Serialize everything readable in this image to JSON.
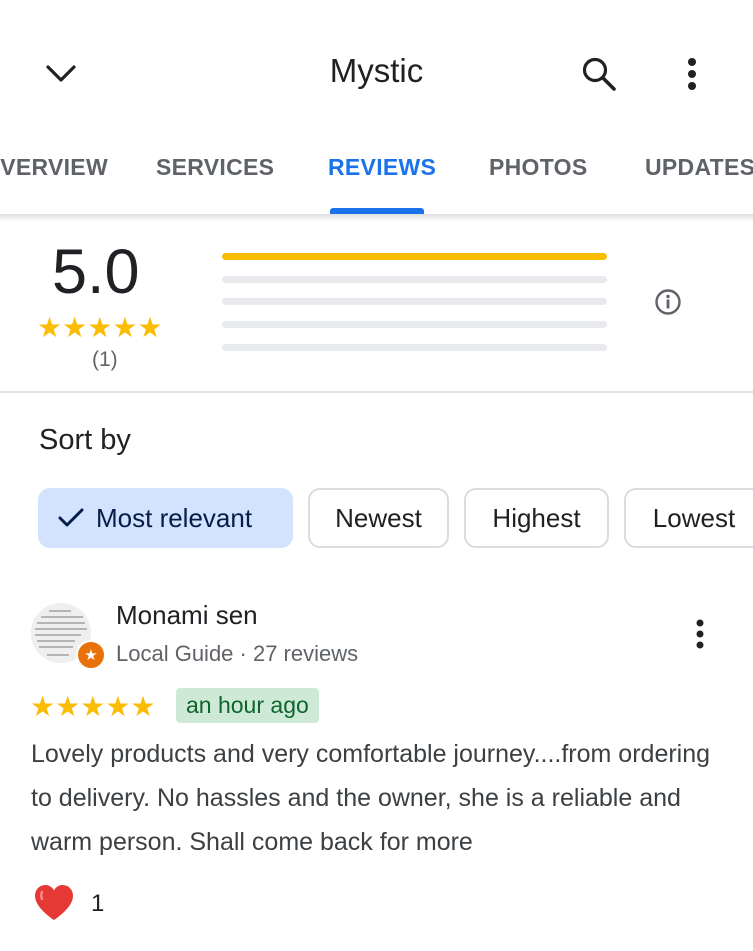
{
  "header": {
    "title": "Mystic",
    "back_icon": "chevron-down-icon",
    "search_icon": "search-icon",
    "menu_icon": "more-vert-icon"
  },
  "tabs": [
    {
      "label": "OVERVIEW",
      "active": false
    },
    {
      "label": "SERVICES",
      "active": false
    },
    {
      "label": "REVIEWS",
      "active": true
    },
    {
      "label": "PHOTOS",
      "active": false
    },
    {
      "label": "UPDATES",
      "active": false
    }
  ],
  "summary": {
    "rating": "5.0",
    "stars": 5,
    "count": "(1)",
    "distribution": [
      {
        "stars": 5,
        "fraction": 1.0
      },
      {
        "stars": 4,
        "fraction": 0
      },
      {
        "stars": 3,
        "fraction": 0
      },
      {
        "stars": 2,
        "fraction": 0
      },
      {
        "stars": 1,
        "fraction": 0
      }
    ],
    "info_icon": "info-icon"
  },
  "sort": {
    "label": "Sort by",
    "options": [
      "Most relevant",
      "Newest",
      "Highest",
      "Lowest"
    ],
    "selected": "Most relevant"
  },
  "review": {
    "author": "Monami sen",
    "meta": "Local Guide · 27 reviews",
    "stars": 5,
    "time": "an hour ago",
    "text": "Lovely products and very comfortable journey....from ordering to delivery. No hassles and the owner, she is a reliable and warm person. Shall come back for more",
    "likes": "1",
    "colors": {
      "star": "#fbbc04",
      "badge_bg": "#ceead6",
      "badge_text": "#0d652d",
      "local_guide": "#e8710a"
    }
  },
  "colors": {
    "accent": "#1a73e8",
    "chip_selected": "#d3e3fd",
    "heart": "#e53935"
  }
}
